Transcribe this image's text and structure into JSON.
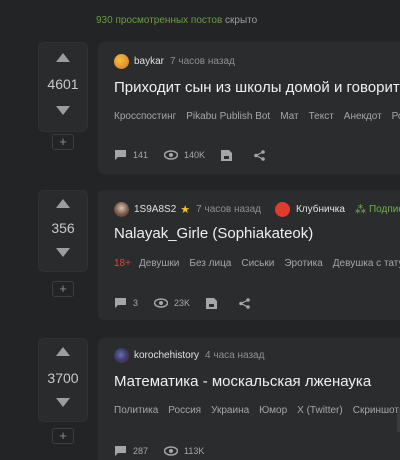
{
  "hidden_note": {
    "count": "930 просмотренных постов",
    "suffix": "скрыто"
  },
  "posts": [
    {
      "rating": "4601",
      "author": "baykar",
      "time": "7 часов назад",
      "title": "Приходит сын из школы домой и говорит",
      "tags": [
        "Кросспостинг",
        "Pikabu Publish Bot",
        "Мат",
        "Текст",
        "Анекдот",
        "Род"
      ],
      "comments": "141",
      "views": "140K"
    },
    {
      "rating": "356",
      "author": "1S9A8S2",
      "time": "7 часов назад",
      "community": "Клубничка",
      "subscribe": "Подписа",
      "title": "Nalayak_Girle (Sophiakateok)",
      "adult_tag": "18+",
      "tags": [
        "Девушки",
        "Без лица",
        "Сиськи",
        "Эротика",
        "Девушка с тату"
      ],
      "comments": "3",
      "views": "23K"
    },
    {
      "rating": "3700",
      "author": "korochehistory",
      "time": "4 часа назад",
      "title": "Математика - москальская лженаука",
      "tags": [
        "Политика",
        "Россия",
        "Украина",
        "Юмор",
        "X (Twitter)",
        "Скриншот"
      ],
      "comments": "287",
      "views": "113K"
    }
  ],
  "icons": {
    "upvote": "arrow-up-icon",
    "downvote": "arrow-down-icon",
    "comments": "comment-icon",
    "views": "eye-icon",
    "save": "save-icon",
    "share": "share-icon",
    "star": "★",
    "subscribe": "⁂",
    "plus": "+"
  },
  "colors": {
    "bg": "#232425",
    "card": "#2b2c2d",
    "accent_green": "#6fb24a",
    "adult_red": "#e6413b"
  }
}
